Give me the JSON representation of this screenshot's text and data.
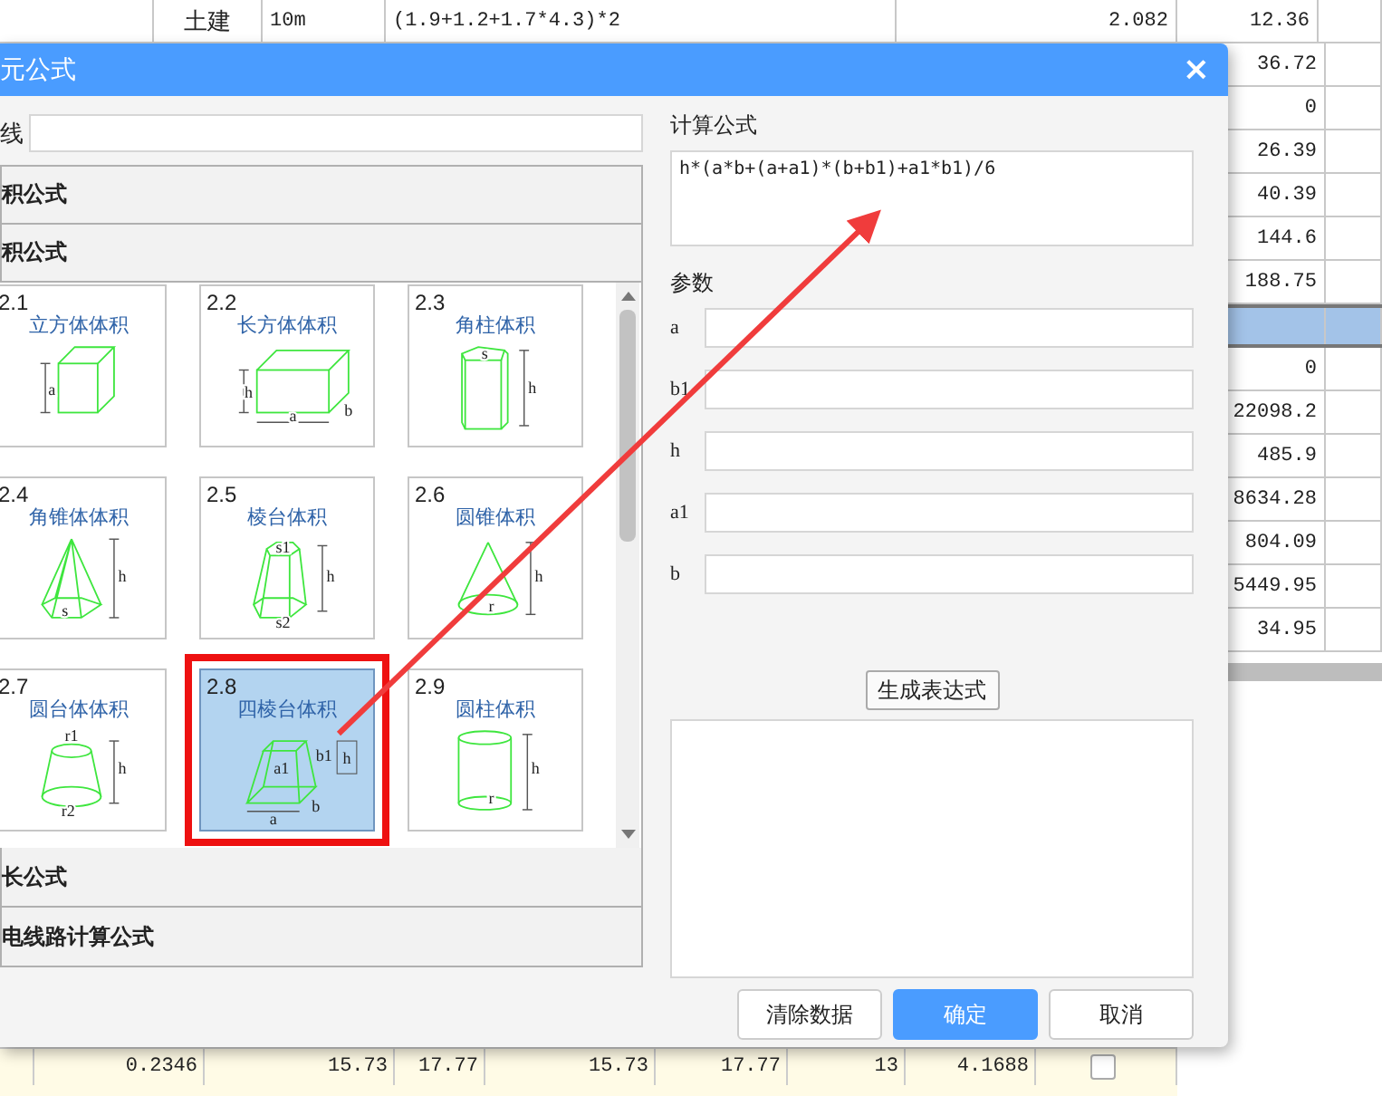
{
  "sheet": {
    "top_row": [
      "土建",
      "10m",
      "(1.9+1.2+1.7*4.3)*2",
      "2.082",
      "12.36"
    ],
    "right_column": [
      {
        "value": "36.72",
        "selected": false
      },
      {
        "value": "0",
        "selected": false
      },
      {
        "value": "26.39",
        "selected": false
      },
      {
        "value": "40.39",
        "selected": false
      },
      {
        "value": "144.6",
        "selected": false
      },
      {
        "value": "188.75",
        "selected": false
      },
      {
        "selected": true
      },
      {
        "value": "0",
        "selected": false
      },
      {
        "value": "22098.2",
        "selected": false
      },
      {
        "value": "485.9",
        "selected": false
      },
      {
        "value": "8634.28",
        "selected": false
      },
      {
        "value": "804.09",
        "selected": false
      },
      {
        "value": "5449.95",
        "selected": false
      },
      {
        "value": "34.95",
        "selected": false
      }
    ],
    "bottom_row": {
      "cells": [
        "0.2346",
        "15.73",
        "17.77",
        "15.73",
        "17.77",
        "13",
        "4.1688"
      ],
      "checked": false
    }
  },
  "dialog": {
    "title": "元公式",
    "close": "×",
    "search": {
      "label": "线"
    },
    "categories": [
      {
        "label": "积公式",
        "expanded": false
      },
      {
        "label": "积公式",
        "expanded": true,
        "items": [
          {
            "number": "2.1",
            "title": "立方体体积",
            "kind": "cube",
            "labels": [
              "a"
            ],
            "selected": false,
            "highlighted": false
          },
          {
            "number": "2.2",
            "title": "长方体体积",
            "kind": "cuboid",
            "labels": [
              "h",
              "a",
              "b"
            ],
            "selected": false,
            "highlighted": false
          },
          {
            "number": "2.3",
            "title": "角柱体积",
            "kind": "prism",
            "labels": [
              "s",
              "h"
            ],
            "selected": false,
            "highlighted": false
          },
          {
            "number": "2.4",
            "title": "角锥体体积",
            "kind": "pyramid",
            "labels": [
              "h",
              "s"
            ],
            "selected": false,
            "highlighted": false
          },
          {
            "number": "2.5",
            "title": "棱台体积",
            "kind": "frustum",
            "labels": [
              "s1",
              "h",
              "s2"
            ],
            "selected": false,
            "highlighted": false
          },
          {
            "number": "2.6",
            "title": "圆锥体积",
            "kind": "cone",
            "labels": [
              "h",
              "r"
            ],
            "selected": false,
            "highlighted": false
          },
          {
            "number": "2.7",
            "title": "圆台体体积",
            "kind": "truncated-cone",
            "labels": [
              "r1",
              "h",
              "r2"
            ],
            "selected": false,
            "highlighted": false
          },
          {
            "number": "2.8",
            "title": "四棱台体积",
            "kind": "square-frustum",
            "labels": [
              "a1",
              "b1",
              "h",
              "a",
              "b"
            ],
            "selected": true,
            "highlighted": true
          },
          {
            "number": "2.9",
            "title": "圆柱体积",
            "kind": "cylinder",
            "labels": [
              "h",
              "r"
            ],
            "selected": false,
            "highlighted": false
          }
        ]
      },
      {
        "label": "长公式",
        "expanded": false
      },
      {
        "label": "电线路计算公式",
        "expanded": false
      }
    ],
    "formula": {
      "label": "计算公式",
      "value": "h*(a*b+(a+a1)*(b+b1)+a1*b1)/6"
    },
    "params": {
      "label": "参数",
      "items": [
        {
          "name": "a"
        },
        {
          "name": "b1"
        },
        {
          "name": "h"
        },
        {
          "name": "a1"
        },
        {
          "name": "b"
        }
      ]
    },
    "generate_button": "生成表达式",
    "buttons": [
      {
        "label": "清除数据",
        "primary": false
      },
      {
        "label": "确定",
        "primary": true
      },
      {
        "label": "取消",
        "primary": false
      }
    ]
  }
}
